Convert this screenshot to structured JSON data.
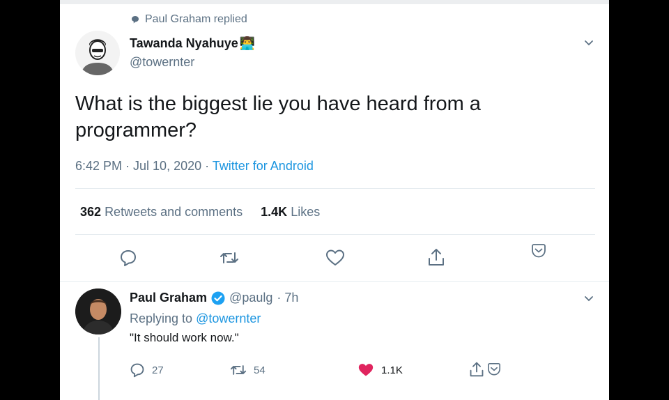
{
  "context": {
    "replied_text": "Paul Graham replied"
  },
  "original_tweet": {
    "author_name": "Tawanda Nyahuye",
    "author_emoji": "👨‍💻",
    "handle": "@towernter",
    "text": "What is the biggest lie you have heard from a programmer?",
    "time": "6:42 PM · Jul 10, 2020",
    "separator": " · ",
    "source": "Twitter for Android",
    "retweets_count": "362",
    "retweets_label": "Retweets and comments",
    "likes_count": "1.4K",
    "likes_label": "Likes"
  },
  "reply_tweet": {
    "author_name": "Paul Graham",
    "handle": "@paulg",
    "age": "· 7h",
    "replying_prefix": "Replying to",
    "replying_to": "@towernter",
    "text": "\"It should work now.\"",
    "reply_count": "27",
    "retweet_count": "54",
    "like_count": "1.1K"
  },
  "colors": {
    "link": "#1b95e0",
    "secondary_text": "#5b7083",
    "primary_text": "#14171a",
    "like_active": "#e0245e",
    "verified": "#1da1f2"
  }
}
